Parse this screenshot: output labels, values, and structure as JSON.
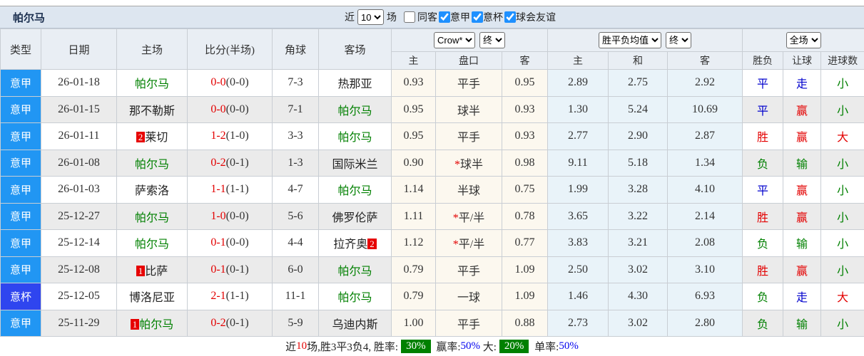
{
  "toolbar": {
    "title": "帕尔马",
    "near_label": "近",
    "near_value": "10",
    "games_label": "场",
    "filters": [
      {
        "label": "同客",
        "checked": false
      },
      {
        "label": "意甲",
        "checked": true
      },
      {
        "label": "意杯",
        "checked": true
      },
      {
        "label": "球会友谊",
        "checked": true
      }
    ]
  },
  "table": {
    "columns": {
      "type": "类型",
      "date": "日期",
      "home": "主场",
      "score": "比分(半场)",
      "corner": "角球",
      "away": "客场",
      "crow_home": "主",
      "handicap": "盘口",
      "crow_away": "客",
      "avg_home": "主",
      "avg_draw": "和",
      "avg_away": "客",
      "result": "胜负",
      "handicap_result": "让球",
      "goals": "进球数"
    },
    "selects": {
      "bookmaker": "Crow*",
      "bookmaker_time": "终",
      "avg": "胜平负均值",
      "avg_time": "终",
      "scope": "全场"
    },
    "rows": [
      {
        "league": {
          "text": "意甲",
          "cup": false
        },
        "date": "26-01-18",
        "home": {
          "name": "帕尔马",
          "green": true
        },
        "score": "0-0",
        "half": "(0-0)",
        "corner": "7-3",
        "away": {
          "name": "热那亚",
          "green": false
        },
        "crow": {
          "home": "0.93",
          "star": false,
          "handicap": "平手",
          "away": "0.95"
        },
        "avg": {
          "home": "2.89",
          "draw": "2.75",
          "away": "2.92"
        },
        "result": {
          "text": "平",
          "c": "blue"
        },
        "let": {
          "text": "走",
          "c": "blue"
        },
        "goal": {
          "text": "小",
          "c": "green"
        }
      },
      {
        "league": {
          "text": "意甲",
          "cup": false
        },
        "date": "26-01-15",
        "home": {
          "name": "那不勒斯",
          "green": false
        },
        "score": "0-0",
        "half": "(0-0)",
        "corner": "7-1",
        "away": {
          "name": "帕尔马",
          "green": true
        },
        "crow": {
          "home": "0.95",
          "star": false,
          "handicap": "球半",
          "away": "0.93"
        },
        "avg": {
          "home": "1.30",
          "draw": "5.24",
          "away": "10.69"
        },
        "result": {
          "text": "平",
          "c": "blue"
        },
        "let": {
          "text": "赢",
          "c": "red"
        },
        "goal": {
          "text": "小",
          "c": "green"
        }
      },
      {
        "league": {
          "text": "意甲",
          "cup": false
        },
        "date": "26-01-11",
        "home": {
          "name": "莱切",
          "green": false,
          "badge": "2",
          "badge_pos": "before"
        },
        "score": "1-2",
        "half": "(1-0)",
        "corner": "3-3",
        "away": {
          "name": "帕尔马",
          "green": true
        },
        "crow": {
          "home": "0.95",
          "star": false,
          "handicap": "平手",
          "away": "0.93"
        },
        "avg": {
          "home": "2.77",
          "draw": "2.90",
          "away": "2.87"
        },
        "result": {
          "text": "胜",
          "c": "red"
        },
        "let": {
          "text": "赢",
          "c": "red"
        },
        "goal": {
          "text": "大",
          "c": "red"
        }
      },
      {
        "league": {
          "text": "意甲",
          "cup": false
        },
        "date": "26-01-08",
        "home": {
          "name": "帕尔马",
          "green": true
        },
        "score": "0-2",
        "half": "(0-1)",
        "corner": "1-3",
        "away": {
          "name": "国际米兰",
          "green": false
        },
        "crow": {
          "home": "0.90",
          "star": true,
          "handicap": "球半",
          "away": "0.98"
        },
        "avg": {
          "home": "9.11",
          "draw": "5.18",
          "away": "1.34"
        },
        "result": {
          "text": "负",
          "c": "green"
        },
        "let": {
          "text": "输",
          "c": "green"
        },
        "goal": {
          "text": "小",
          "c": "green"
        }
      },
      {
        "league": {
          "text": "意甲",
          "cup": false
        },
        "date": "26-01-03",
        "home": {
          "name": "萨索洛",
          "green": false
        },
        "score": "1-1",
        "half": "(1-1)",
        "corner": "4-7",
        "away": {
          "name": "帕尔马",
          "green": true
        },
        "crow": {
          "home": "1.14",
          "star": false,
          "handicap": "半球",
          "away": "0.75"
        },
        "avg": {
          "home": "1.99",
          "draw": "3.28",
          "away": "4.10"
        },
        "result": {
          "text": "平",
          "c": "blue"
        },
        "let": {
          "text": "赢",
          "c": "red"
        },
        "goal": {
          "text": "小",
          "c": "green"
        }
      },
      {
        "league": {
          "text": "意甲",
          "cup": false
        },
        "date": "25-12-27",
        "home": {
          "name": "帕尔马",
          "green": true
        },
        "score": "1-0",
        "half": "(0-0)",
        "corner": "5-6",
        "away": {
          "name": "佛罗伦萨",
          "green": false
        },
        "crow": {
          "home": "1.11",
          "star": true,
          "handicap": "平/半",
          "away": "0.78"
        },
        "avg": {
          "home": "3.65",
          "draw": "3.22",
          "away": "2.14"
        },
        "result": {
          "text": "胜",
          "c": "red"
        },
        "let": {
          "text": "赢",
          "c": "red"
        },
        "goal": {
          "text": "小",
          "c": "green"
        }
      },
      {
        "league": {
          "text": "意甲",
          "cup": false
        },
        "date": "25-12-14",
        "home": {
          "name": "帕尔马",
          "green": true
        },
        "score": "0-1",
        "half": "(0-0)",
        "corner": "4-4",
        "away": {
          "name": "拉齐奥",
          "green": false,
          "badge": "2",
          "badge_pos": "after"
        },
        "crow": {
          "home": "1.12",
          "star": true,
          "handicap": "平/半",
          "away": "0.77"
        },
        "avg": {
          "home": "3.83",
          "draw": "3.21",
          "away": "2.08"
        },
        "result": {
          "text": "负",
          "c": "green"
        },
        "let": {
          "text": "输",
          "c": "green"
        },
        "goal": {
          "text": "小",
          "c": "green"
        }
      },
      {
        "league": {
          "text": "意甲",
          "cup": false
        },
        "date": "25-12-08",
        "home": {
          "name": "比萨",
          "green": false,
          "badge": "1",
          "badge_pos": "before"
        },
        "score": "0-1",
        "half": "(0-1)",
        "corner": "6-0",
        "away": {
          "name": "帕尔马",
          "green": true
        },
        "crow": {
          "home": "0.79",
          "star": false,
          "handicap": "平手",
          "away": "1.09"
        },
        "avg": {
          "home": "2.50",
          "draw": "3.02",
          "away": "3.10"
        },
        "result": {
          "text": "胜",
          "c": "red"
        },
        "let": {
          "text": "赢",
          "c": "red"
        },
        "goal": {
          "text": "小",
          "c": "green"
        }
      },
      {
        "league": {
          "text": "意杯",
          "cup": true
        },
        "date": "25-12-05",
        "home": {
          "name": "博洛尼亚",
          "green": false
        },
        "score": "2-1",
        "half": "(1-1)",
        "corner": "11-1",
        "away": {
          "name": "帕尔马",
          "green": true
        },
        "crow": {
          "home": "0.79",
          "star": false,
          "handicap": "一球",
          "away": "1.09"
        },
        "avg": {
          "home": "1.46",
          "draw": "4.30",
          "away": "6.93"
        },
        "result": {
          "text": "负",
          "c": "green"
        },
        "let": {
          "text": "走",
          "c": "blue"
        },
        "goal": {
          "text": "大",
          "c": "red"
        }
      },
      {
        "league": {
          "text": "意甲",
          "cup": false
        },
        "date": "25-11-29",
        "home": {
          "name": "帕尔马",
          "green": true,
          "badge": "1",
          "badge_pos": "before"
        },
        "score": "0-2",
        "half": "(0-1)",
        "corner": "5-9",
        "away": {
          "name": "乌迪内斯",
          "green": false
        },
        "crow": {
          "home": "1.00",
          "star": false,
          "handicap": "平手",
          "away": "0.88"
        },
        "avg": {
          "home": "2.73",
          "draw": "3.02",
          "away": "2.80"
        },
        "result": {
          "text": "负",
          "c": "green"
        },
        "let": {
          "text": "输",
          "c": "green"
        },
        "goal": {
          "text": "小",
          "c": "green"
        }
      }
    ]
  },
  "summary": {
    "prefix": "近",
    "count": "10",
    "record": "场,胜3平3负4, 胜率:",
    "win_rate": "30%",
    "label_win_odds": " 赢率:",
    "win_odds_rate": "50%",
    "label_big": " 大:",
    "big_rate": "20%",
    "label_single": " 单率:",
    "single_rate": "50%"
  }
}
